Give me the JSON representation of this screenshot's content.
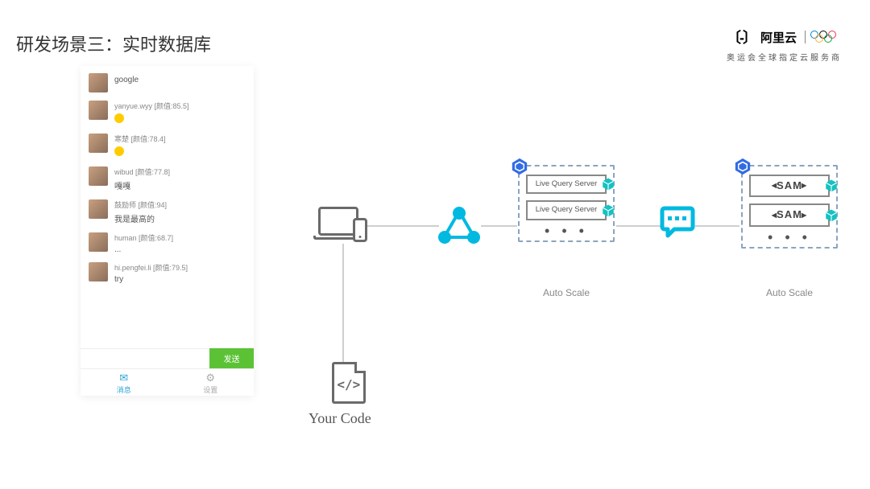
{
  "slide": {
    "title": "研发场景三：实时数据库"
  },
  "branding": {
    "logo_text": "阿里云",
    "tagline": "奥运会全球指定云服务商"
  },
  "phone": {
    "messages": [
      {
        "name": "...",
        "msg": "google"
      },
      {
        "name": "yanyue.wyy [颜值:85.5]",
        "msg": "😏"
      },
      {
        "name": "寒楚 [颜值:78.4]",
        "msg": "😂"
      },
      {
        "name": "wibud [颜值:77.8]",
        "msg": "嘎嘎"
      },
      {
        "name": "鼓励师 [颜值:94]",
        "msg": "我是最高的"
      },
      {
        "name": "human [颜值:68.7]",
        "msg": "..."
      },
      {
        "name": "hi.pengfei.li [颜值:79.5]",
        "msg": "try"
      }
    ],
    "send_label": "发送",
    "nav": {
      "messages": "消息",
      "settings": "设置"
    }
  },
  "diagram": {
    "your_code_label": "Your Code",
    "live_query_1": "Live Query Server",
    "live_query_2": "Live Query Server",
    "sam_1": "SAM",
    "sam_2": "SAM",
    "auto_scale_1": "Auto Scale",
    "auto_scale_2": "Auto Scale"
  }
}
